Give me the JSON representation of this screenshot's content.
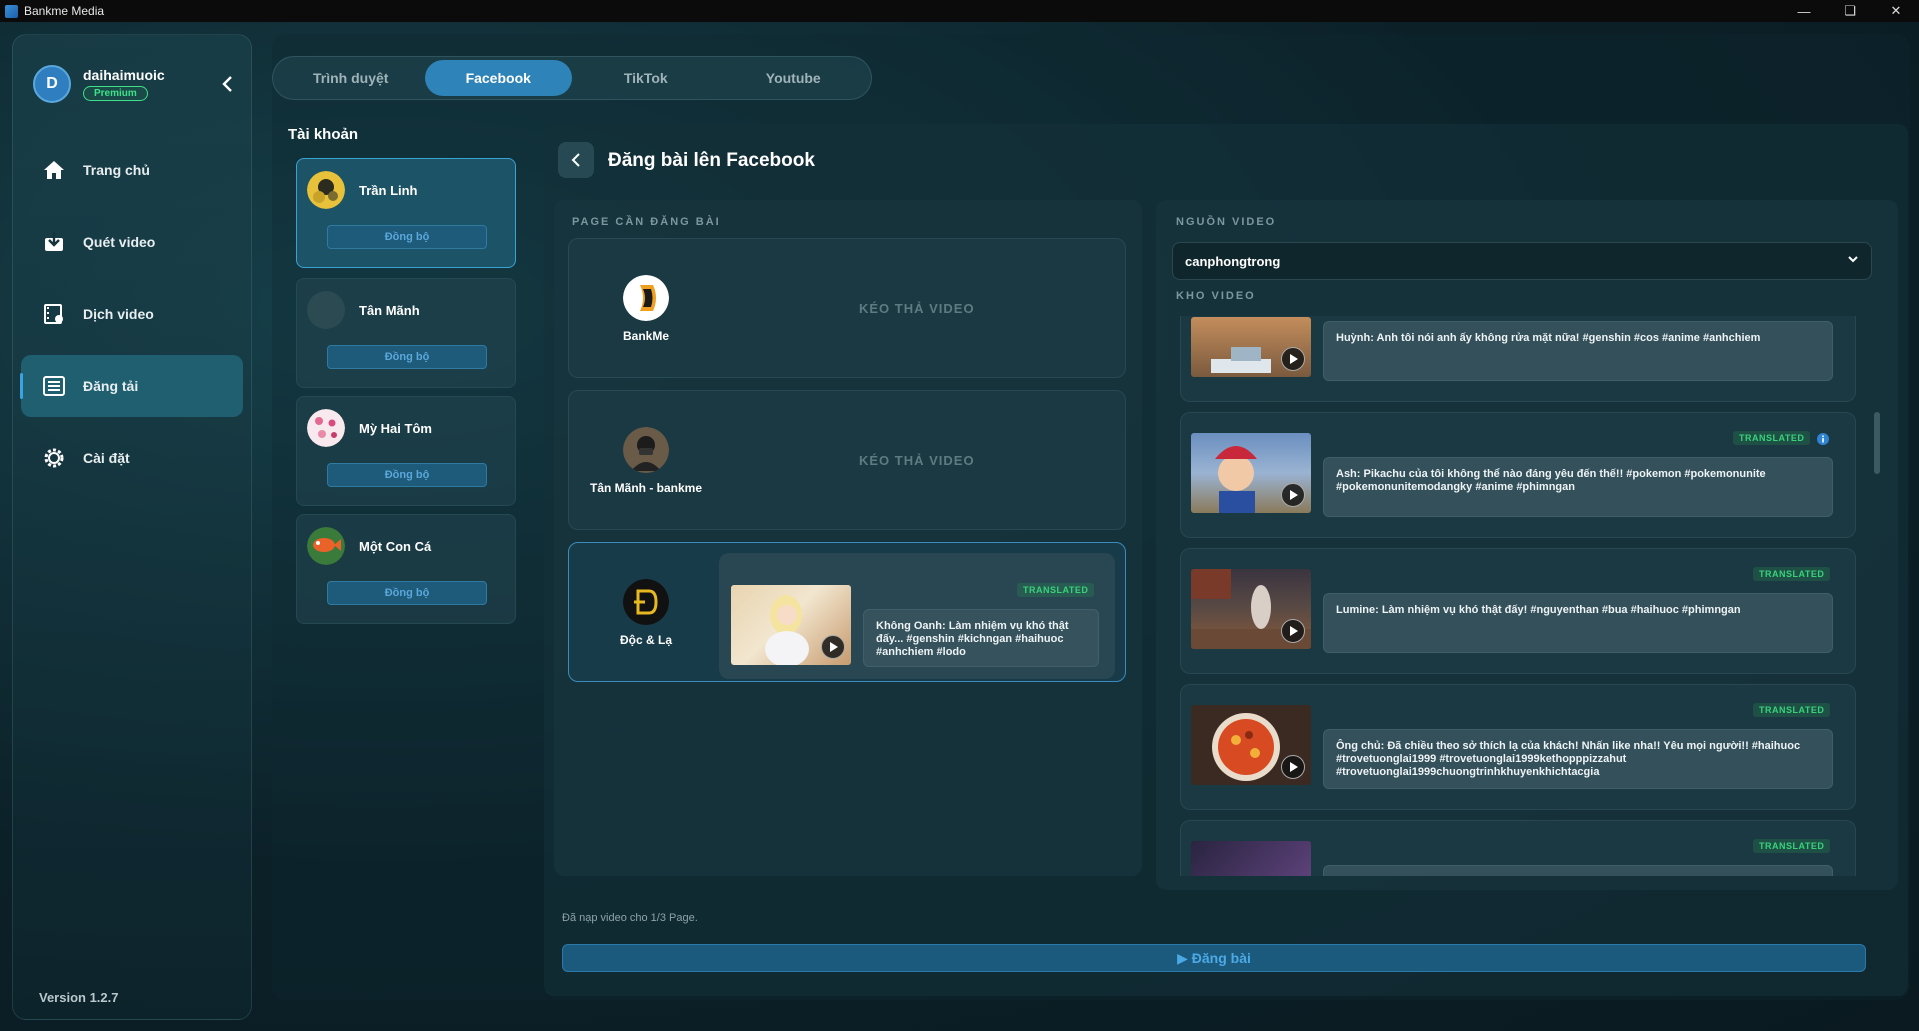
{
  "window": {
    "title": "Bankme Media",
    "controls": [
      "minimize",
      "restore",
      "close"
    ]
  },
  "profile": {
    "initial": "D",
    "username": "daihaimuoic",
    "badge": "Premium"
  },
  "nav": [
    {
      "label": "Trang chủ",
      "icon": "home-icon"
    },
    {
      "label": "Quét video",
      "icon": "download-icon"
    },
    {
      "label": "Dịch video",
      "icon": "film-icon"
    },
    {
      "label": "Đăng tải",
      "icon": "list-icon",
      "active": true
    },
    {
      "label": "Cài đặt",
      "icon": "gear-icon"
    }
  ],
  "version": "Version 1.2.7",
  "tabs": [
    {
      "label": "Trình duyệt"
    },
    {
      "label": "Facebook",
      "active": true
    },
    {
      "label": "TikTok"
    },
    {
      "label": "Youtube"
    }
  ],
  "accounts": {
    "title": "Tài khoản",
    "items": [
      {
        "name": "Trần Linh",
        "sync": "Đồng bộ",
        "active": true
      },
      {
        "name": "Tân Mãnh",
        "sync": "Đồng bộ"
      },
      {
        "name": "Mỳ Hai Tôm",
        "sync": "Đồng bộ"
      },
      {
        "name": "Một Con Cá",
        "sync": "Đồng bộ"
      }
    ]
  },
  "post": {
    "title": "Đăng bài lên Facebook",
    "pages_label": "PAGE CẦN ĐĂNG BÀI",
    "pages": [
      {
        "name": "BankMe",
        "drop": "KÉO THẢ VIDEO"
      },
      {
        "name": "Tân Mãnh - bankme",
        "drop": "KÉO THẢ VIDEO"
      },
      {
        "name": "Độc & Lạ",
        "assigned": {
          "badge": "TRANSLATED",
          "caption": "Không Oanh: Làm nhiệm vụ khó thật đấy... #genshin #kichngan #haihuoc #anhchiem #lodo"
        }
      }
    ],
    "source_label": "NGUỒN VIDEO",
    "source_value": "canphongtrong",
    "library_label": "KHO VIDEO",
    "videos": [
      {
        "badge": "",
        "caption": "Huỳnh: Anh tôi nói anh ấy không rửa mặt nữa! #genshin #cos #anime #anhchiem"
      },
      {
        "badge": "TRANSLATED",
        "caption": "Ash: Pikachu của tôi không thể nào đáng yêu đến thế!! #pokemon #pokemonunite #pokemonunitemodangky #anime #phimngan"
      },
      {
        "badge": "TRANSLATED",
        "caption": "Lumine: Làm nhiệm vụ khó thật đấy! #nguyenthan #bua #haihuoc #phimngan"
      },
      {
        "badge": "TRANSLATED",
        "caption": "Ông chủ: Đã chiều theo sở thích lạ của khách! Nhấn like nha!! Yêu mọi người!! #haihuoc #trovetuonglai1999 #trovetuonglai1999kethopppizzahut #trovetuonglai1999chuongtrinhkhuyenkhichtacgia"
      },
      {
        "badge": "TRANSLATED",
        "caption": ""
      }
    ],
    "status": "Đã nạp video cho 1/3 Page.",
    "submit": "▶ Đăng bài"
  }
}
